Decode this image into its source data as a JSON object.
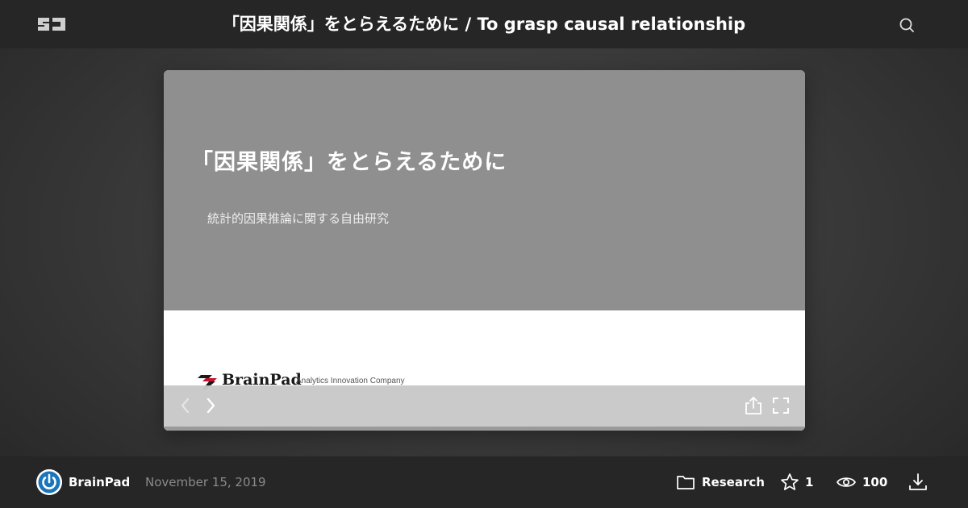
{
  "header": {
    "logo_text": "SJ",
    "title": "「因果関係」をとらえるために / To grasp causal relationship",
    "search_icon": "search-icon"
  },
  "slide": {
    "heading": "「因果関係」をとらえるために",
    "subtitle": "統計的因果推論に関する自由研究",
    "brand_name": "BrainPad",
    "brand_tagline": "Analytics Innovation Company",
    "controls": {
      "prev_icon": "chevron-left-icon",
      "next_icon": "chevron-right-icon",
      "share_icon": "share-icon",
      "fullscreen_icon": "fullscreen-icon"
    }
  },
  "footer": {
    "author": "BrainPad",
    "date": "November 15, 2019",
    "category": "Research",
    "stars": "1",
    "views": "100",
    "download_icon": "download-icon"
  },
  "colors": {
    "header_bg": "#262626",
    "slide_top": "#8f8f8f",
    "controls_bg": "#c8c8c8",
    "avatar_blue": "#1b75bb",
    "brand_red": "#c8102e"
  }
}
